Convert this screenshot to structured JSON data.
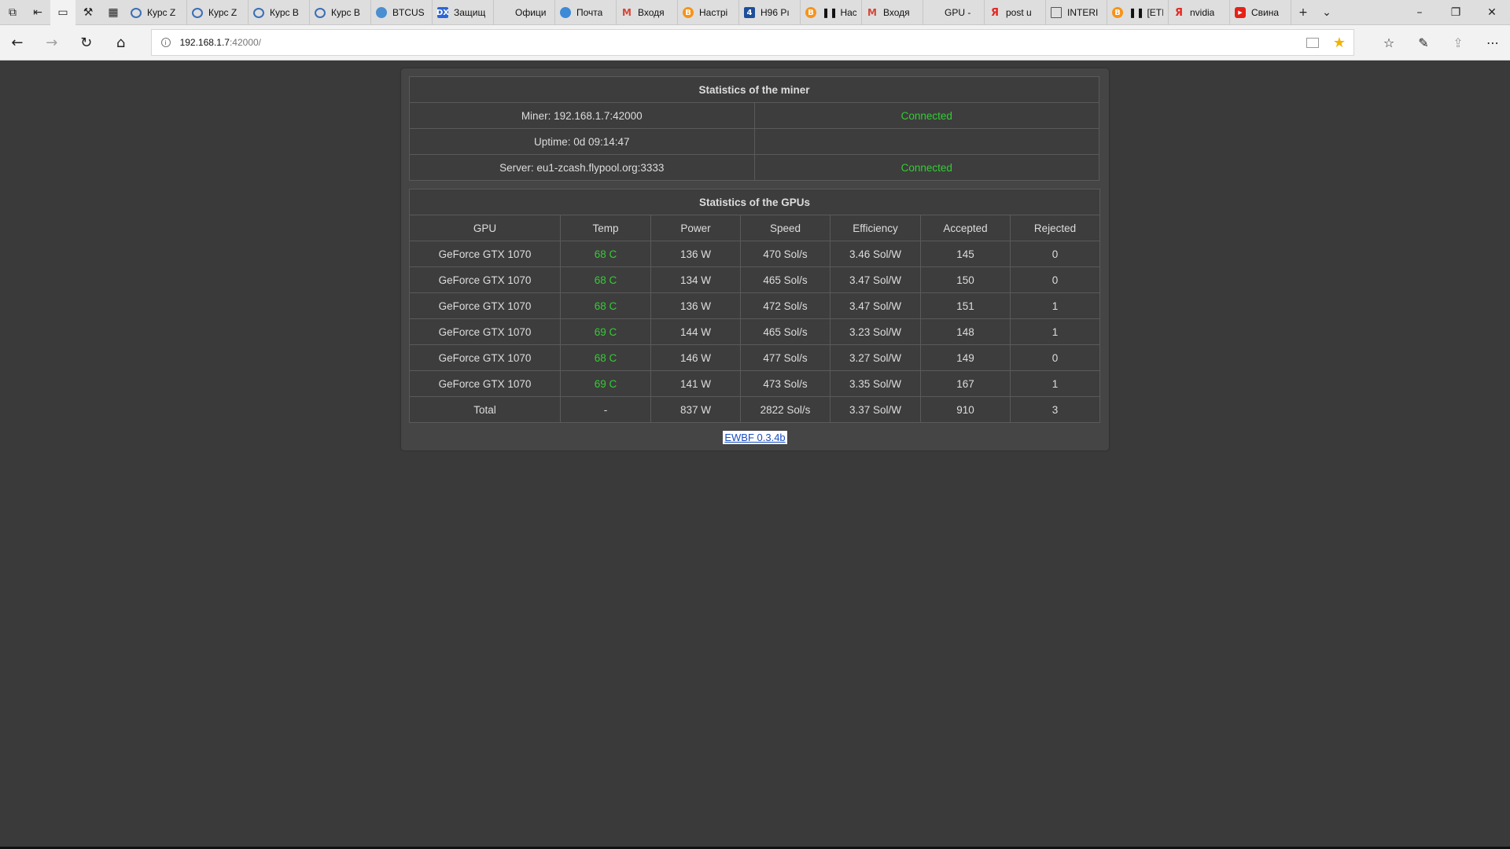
{
  "browser": {
    "tabs": [
      {
        "label": "Курс Z",
        "fav": "ring"
      },
      {
        "label": "Курс Z",
        "fav": "ring"
      },
      {
        "label": "Курс B",
        "fav": "ring"
      },
      {
        "label": "Курс B",
        "fav": "ring"
      },
      {
        "label": "BTCUS",
        "fav": "globe"
      },
      {
        "label": "Защищ",
        "fav": "dx",
        "glyph": "DX"
      },
      {
        "label": "Офици",
        "fav": "none"
      },
      {
        "label": "Почта",
        "fav": "pochta"
      },
      {
        "label": "Входя",
        "fav": "gmail",
        "glyph": "M"
      },
      {
        "label": "Настрі",
        "fav": "btc",
        "glyph": "B"
      },
      {
        "label": "H96 Pı",
        "fav": "h96",
        "glyph": "4"
      },
      {
        "label": "❚❚ Нас",
        "fav": "btc",
        "glyph": "B"
      },
      {
        "label": "Входя",
        "fav": "gmail",
        "glyph": "M"
      },
      {
        "label": "GPU -",
        "fav": "none"
      },
      {
        "label": "post u",
        "fav": "ya",
        "glyph": "Я"
      },
      {
        "label": "INTERI",
        "fav": "doc"
      },
      {
        "label": "❚❚ [ETI",
        "fav": "btc",
        "glyph": "B"
      },
      {
        "label": "nvidia",
        "fav": "ya",
        "glyph": "Я"
      },
      {
        "label": "Свина",
        "fav": "yt",
        "glyph": "▶"
      }
    ],
    "address": {
      "host": "192.168.1.7",
      "path": ":42000/"
    }
  },
  "miner_table": {
    "title": "Statistics of the miner",
    "rows": [
      {
        "label": "Miner: 192.168.1.7:42000",
        "status": "Connected"
      },
      {
        "label": "Uptime: 0d 09:14:47",
        "status": ""
      },
      {
        "label": "Server: eu1-zcash.flypool.org:3333",
        "status": "Connected"
      }
    ]
  },
  "gpu_table": {
    "title": "Statistics of the GPUs",
    "headers": [
      "GPU",
      "Temp",
      "Power",
      "Speed",
      "Efficiency",
      "Accepted",
      "Rejected"
    ],
    "rows": [
      [
        "GeForce GTX 1070",
        "68 C",
        "136 W",
        "470 Sol/s",
        "3.46 Sol/W",
        "145",
        "0"
      ],
      [
        "GeForce GTX 1070",
        "68 C",
        "134 W",
        "465 Sol/s",
        "3.47 Sol/W",
        "150",
        "0"
      ],
      [
        "GeForce GTX 1070",
        "68 C",
        "136 W",
        "472 Sol/s",
        "3.47 Sol/W",
        "151",
        "1"
      ],
      [
        "GeForce GTX 1070",
        "69 C",
        "144 W",
        "465 Sol/s",
        "3.23 Sol/W",
        "148",
        "1"
      ],
      [
        "GeForce GTX 1070",
        "68 C",
        "146 W",
        "477 Sol/s",
        "3.27 Sol/W",
        "149",
        "0"
      ],
      [
        "GeForce GTX 1070",
        "69 C",
        "141 W",
        "473 Sol/s",
        "3.35 Sol/W",
        "167",
        "1"
      ]
    ],
    "total": [
      "Total",
      "-",
      "837 W",
      "2822 Sol/s",
      "3.37 Sol/W",
      "910",
      "3"
    ]
  },
  "footer": {
    "version_link": "EWBF 0.3.4b"
  },
  "colors": {
    "status_green": "#33cc33",
    "page_bg": "#3a3a3a",
    "panel_bg": "#454545"
  }
}
